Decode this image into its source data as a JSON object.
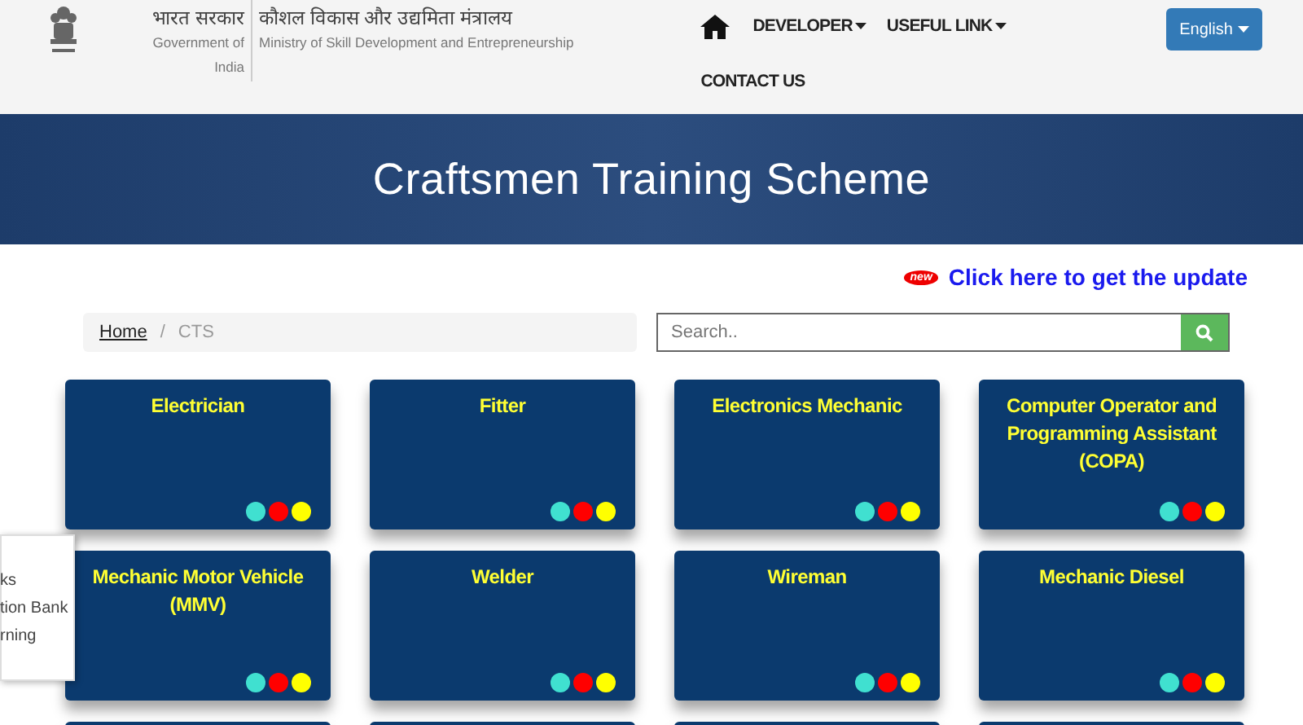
{
  "header": {
    "gov_hindi": "भारत सरकार",
    "gov_english": "Government of India",
    "ministry_hindi": "कौशल विकास और उद्यमिता मंत्रालय",
    "ministry_english": "Ministry of Skill Development and Entrepreneurship"
  },
  "nav": [
    {
      "label": "DEVELOPER",
      "kind": "dropdown"
    },
    {
      "label": "USEFUL LINK",
      "kind": "dropdown"
    },
    {
      "label": "CONTACT US",
      "kind": "link"
    }
  ],
  "language_button": "English",
  "banner_title": "Craftsmen Training Scheme",
  "notice": {
    "badge": "new",
    "text": "Click here to get the update"
  },
  "breadcrumb_separator": "/",
  "breadcrumb": [
    {
      "label": "Home",
      "kind": "link"
    },
    {
      "label": "CTS",
      "kind": "current"
    }
  ],
  "search": {
    "placeholder": "Search.."
  },
  "popup_menu": [
    "ks",
    "tion Bank",
    "rning"
  ],
  "cards": [
    {
      "title": "Electrician",
      "dots": [
        {
          "color": "#40e0d0"
        },
        {
          "color": "#ff0000"
        },
        {
          "color": "#ffff00"
        }
      ]
    },
    {
      "title": "Fitter",
      "dots": [
        {
          "color": "#40e0d0"
        },
        {
          "color": "#ff0000"
        },
        {
          "color": "#ffff00"
        }
      ]
    },
    {
      "title": "Electronics Mechanic",
      "dots": [
        {
          "color": "#40e0d0"
        },
        {
          "color": "#ff0000"
        },
        {
          "color": "#ffff00"
        }
      ]
    },
    {
      "title": "Computer Operator and Programming Assistant (COPA)",
      "dots": [
        {
          "color": "#40e0d0"
        },
        {
          "color": "#ff0000"
        },
        {
          "color": "#ffff00"
        }
      ]
    },
    {
      "title": "Mechanic Motor Vehicle (MMV)",
      "dots": [
        {
          "color": "#40e0d0"
        },
        {
          "color": "#ff0000"
        },
        {
          "color": "#ffff00"
        }
      ]
    },
    {
      "title": "Welder",
      "dots": [
        {
          "color": "#40e0d0"
        },
        {
          "color": "#ff0000"
        },
        {
          "color": "#ffff00"
        }
      ]
    },
    {
      "title": "Wireman",
      "dots": [
        {
          "color": "#40e0d0"
        },
        {
          "color": "#ff0000"
        },
        {
          "color": "#ffff00"
        }
      ]
    },
    {
      "title": "Mechanic Diesel",
      "dots": [
        {
          "color": "#40e0d0"
        },
        {
          "color": "#ff0000"
        },
        {
          "color": "#ffff00"
        }
      ]
    }
  ]
}
